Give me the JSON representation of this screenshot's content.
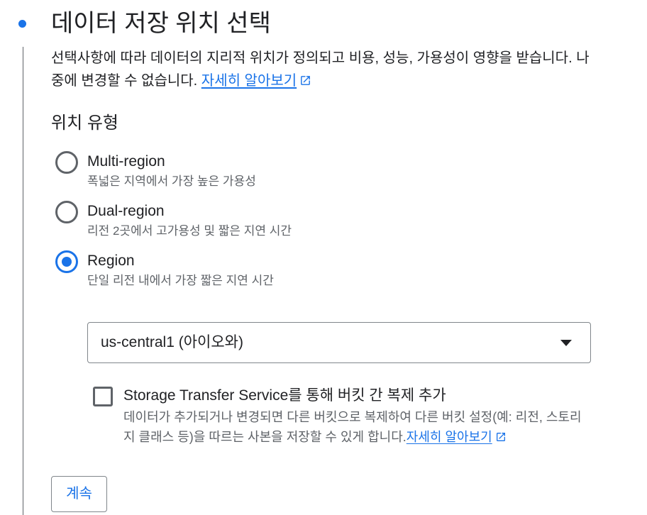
{
  "title": "데이터 저장 위치 선택",
  "description": {
    "text": "선택사항에 따라 데이터의 지리적 위치가 정의되고 비용, 성능, 가용성이 영향을 받습니다. 나중에 변경할 수 없습니다. ",
    "link": "자세히 알아보기",
    "link_icon": "external-link-icon"
  },
  "location_type": {
    "title": "위치 유형",
    "selected": "Region",
    "options": [
      {
        "label": "Multi-region",
        "description": "폭넓은 지역에서 가장 높은 가용성"
      },
      {
        "label": "Dual-region",
        "description": "리전 2곳에서 고가용성 및 짧은 지연 시간"
      },
      {
        "label": "Region",
        "description": "단일 리전 내에서 가장 짧은 지연 시간"
      }
    ]
  },
  "region_select": {
    "value": "us-central1 (아이오와)",
    "icon": "dropdown-arrow-icon"
  },
  "transfer": {
    "label": "Storage Transfer Service를 통해 버킷 간 복제 추가",
    "description": "데이터가 추가되거나 변경되면 다른 버킷으로 복제하여 다른 버킷 설정(예: 리전, 스토리지 클래스 등)을 따르는 사본을 저장할 수 있게 합니다.",
    "link": "자세히 알아보기",
    "checked": false
  },
  "continue_button": "계속",
  "colors": {
    "accent": "#1a73e8",
    "text": "#202124",
    "secondary_text": "#5f6368",
    "border": "#80868b"
  }
}
